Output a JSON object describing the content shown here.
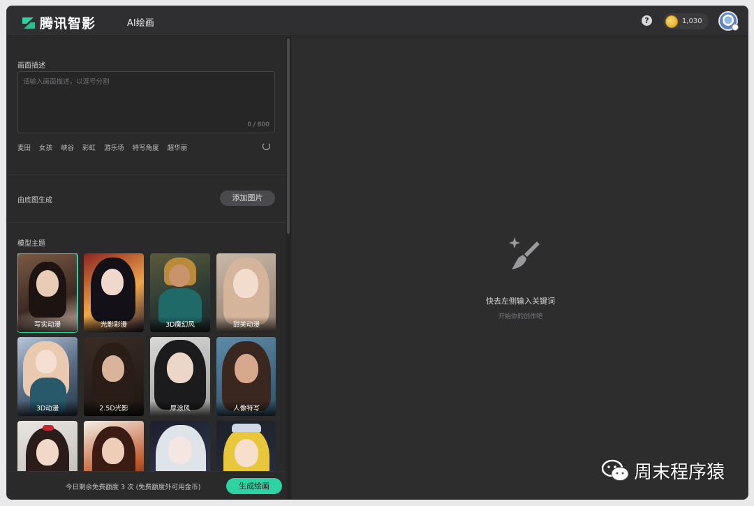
{
  "header": {
    "brand": "腾讯智影",
    "tab": "AI绘画",
    "coins": "1,030",
    "help_icon": "question-circle-icon",
    "coin_icon": "gold-coin-icon"
  },
  "left": {
    "description": {
      "title": "画面描述",
      "placeholder": "请输入画面描述，以逗号分割",
      "counter": "0 / 800",
      "tags": [
        "麦田",
        "女孩",
        "峡谷",
        "彩虹",
        "游乐场",
        "特写角度",
        "超华丽"
      ],
      "refresh_icon": "refresh-icon"
    },
    "base_image": {
      "title": "由底图生成",
      "button": "添加图片"
    },
    "models": {
      "title": "模型主题",
      "items": [
        {
          "label": "写实动漫",
          "selected": true
        },
        {
          "label": "光影彩漫",
          "selected": false
        },
        {
          "label": "3D魔幻风",
          "selected": false
        },
        {
          "label": "甜美动漫",
          "selected": false
        },
        {
          "label": "3D动漫",
          "selected": false
        },
        {
          "label": "2.5D光影",
          "selected": false
        },
        {
          "label": "厚涂风",
          "selected": false
        },
        {
          "label": "人像特写",
          "selected": false
        },
        {
          "label": "",
          "selected": false
        },
        {
          "label": "",
          "selected": false
        },
        {
          "label": "",
          "selected": false
        },
        {
          "label": "",
          "selected": false
        }
      ]
    },
    "footer": {
      "quota": "今日剩余免费额度 3 次 (免费额度外可用金币)",
      "generate": "生成绘画"
    }
  },
  "right": {
    "empty_icon": "magic-brush-icon",
    "empty_title": "快去左侧输入关键词",
    "empty_subtitle": "开始你的创作吧"
  },
  "watermark": {
    "text": "周末程序猿",
    "icon": "wechat-icon"
  },
  "colors": {
    "accent": "#2ed3a4",
    "panel": "#2a2a2b"
  }
}
